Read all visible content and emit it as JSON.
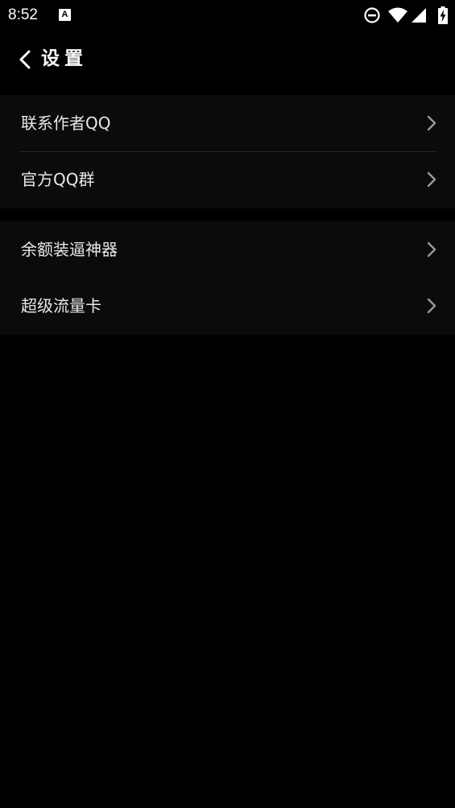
{
  "status_bar": {
    "time": "8:52",
    "app_icon_letter": "A",
    "icons": [
      "dnd-icon",
      "wifi-icon",
      "cell-signal-icon",
      "battery-charging-icon"
    ]
  },
  "header": {
    "title": "设置",
    "back_icon": "chevron-left-icon"
  },
  "groups": [
    {
      "items": [
        {
          "label": "联系作者QQ"
        },
        {
          "label": "官方QQ群"
        }
      ]
    },
    {
      "items": [
        {
          "label": "余额装逼神器"
        },
        {
          "label": "超级流量卡"
        }
      ]
    }
  ],
  "colors": {
    "background": "#000000",
    "row_background": "#0b0b0b",
    "divider": "#2a2a2a",
    "text": "#e8e8e8",
    "chevron": "#9a9a9a"
  }
}
